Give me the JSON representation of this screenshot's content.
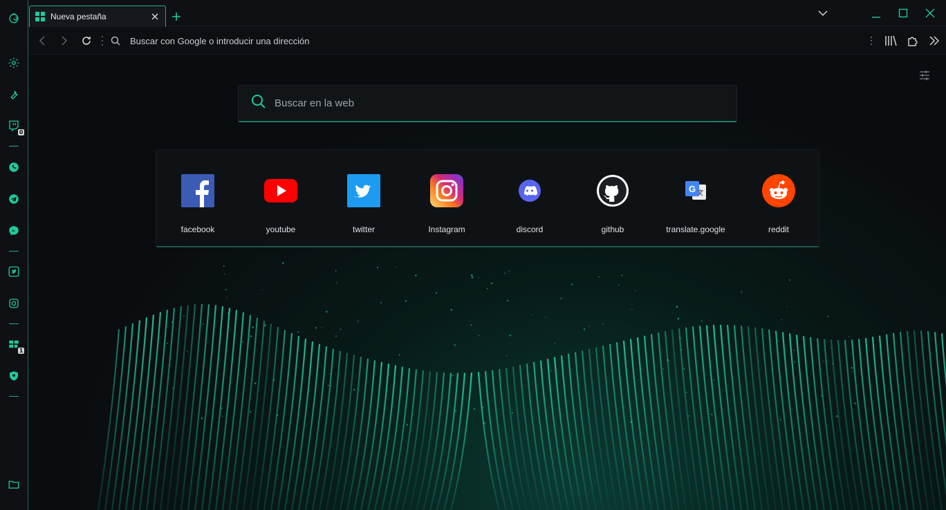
{
  "colors": {
    "accent": "#1fc99d",
    "accent_dark": "#1b7a64",
    "background": "#0a0c0f"
  },
  "tab": {
    "title": "Nueva pestaña"
  },
  "addressbar": {
    "placeholder": "Buscar con Google o introducir una dirección"
  },
  "search": {
    "placeholder": "Buscar en la web"
  },
  "sidebar": {
    "badges": {
      "twitch": "0",
      "workspaces": "1"
    },
    "items": [
      "logo",
      "settings",
      "tools",
      "twitch",
      "whatsapp",
      "telegram",
      "messenger",
      "twitter",
      "instagram",
      "workspaces",
      "vpn",
      "downloads-folder"
    ]
  },
  "shortcuts": [
    {
      "label": "facebook",
      "icon": "facebook-logo-icon"
    },
    {
      "label": "youtube",
      "icon": "youtube-logo-icon"
    },
    {
      "label": "twitter",
      "icon": "twitter-logo-icon"
    },
    {
      "label": "Instagram",
      "icon": "instagram-logo-icon"
    },
    {
      "label": "discord",
      "icon": "discord-logo-icon"
    },
    {
      "label": "github",
      "icon": "github-logo-icon"
    },
    {
      "label": "translate.google",
      "icon": "google-translate-logo-icon"
    },
    {
      "label": "reddit",
      "icon": "reddit-logo-icon"
    }
  ]
}
